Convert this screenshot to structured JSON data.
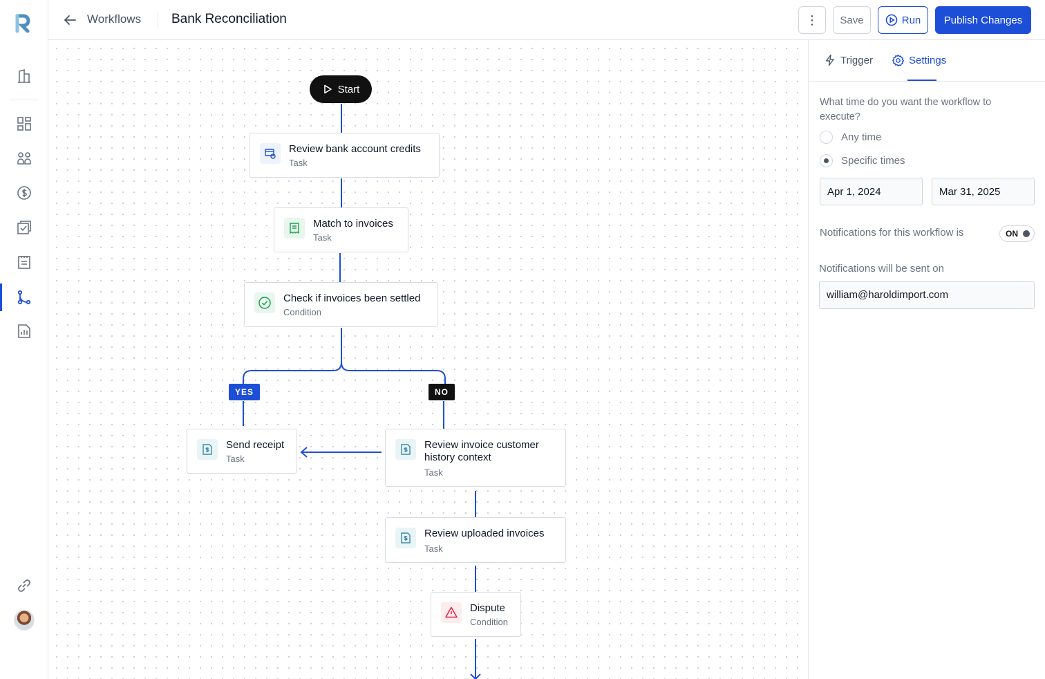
{
  "header": {
    "breadcrumb": "Workflows",
    "title": "Bank Reconciliation",
    "more_label": "⋮",
    "save_label": "Save",
    "run_label": "Run",
    "publish_label": "Publish Changes"
  },
  "sidebar": {
    "icons": [
      "logo-icon",
      "building-icon",
      "dashboard-icon",
      "team-icon",
      "dollar-icon",
      "checklist-icon",
      "clipboard-icon",
      "workflow-icon",
      "report-icon",
      "link-icon"
    ],
    "active": "workflow-icon"
  },
  "workflow": {
    "start_label": "Start",
    "nodes": [
      {
        "title": "Review bank account credits",
        "type": "Task",
        "icon": "bank-card-icon"
      },
      {
        "title": "Match to invoices",
        "type": "Task",
        "icon": "receipt-icon"
      },
      {
        "title": "Check if invoices been settled",
        "type": "Condition",
        "icon": "check-circle-icon"
      },
      {
        "title": "Send receipt",
        "type": "Task",
        "icon": "invoice-icon"
      },
      {
        "title": "Review invoice customer history context",
        "type": "Task",
        "icon": "invoice-icon"
      },
      {
        "title": "Review uploaded invoices",
        "type": "Task",
        "icon": "invoice-icon"
      },
      {
        "title": "Dispute",
        "type": "Condition",
        "icon": "warning-icon"
      }
    ],
    "yes_label": "YES",
    "no_label": "NO"
  },
  "panel": {
    "tabs": [
      {
        "label": "Trigger",
        "icon": "bolt-icon"
      },
      {
        "label": "Settings",
        "icon": "gear-icon"
      }
    ],
    "active_tab": "Settings",
    "question": "What time do you want the workflow to execute?",
    "options": [
      {
        "label": "Any time",
        "selected": false
      },
      {
        "label": "Specific times",
        "selected": true
      }
    ],
    "start_date": "Apr 1, 2024",
    "end_date": "Mar 31, 2025",
    "notifications_label": "Notifications for this workflow is",
    "notifications_state": "ON",
    "sent_on_label": "Notifications will be sent on",
    "email": "william@haroldimport.com"
  },
  "colors": {
    "accent": "#1d4ed8",
    "dark": "#111111",
    "link": "#1d4ed8"
  }
}
